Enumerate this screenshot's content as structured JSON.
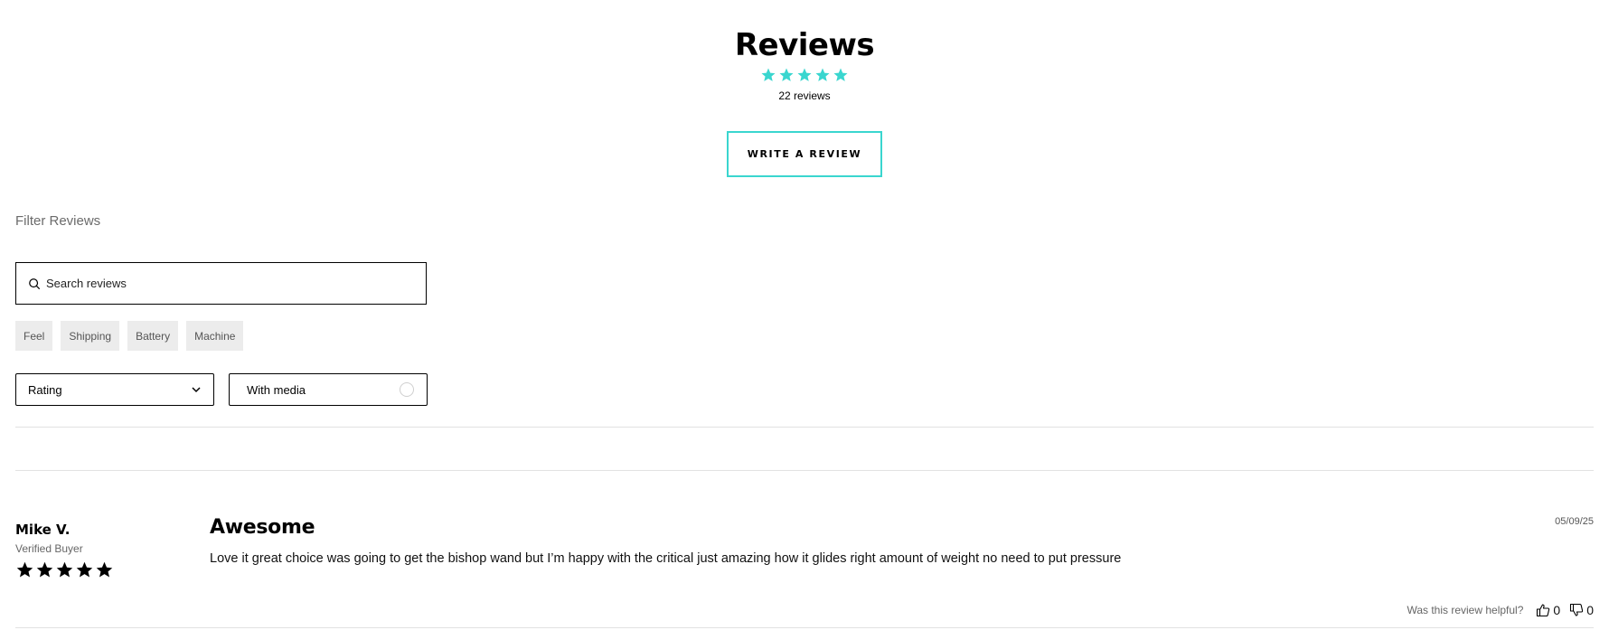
{
  "header": {
    "title": "Reviews",
    "average_rating": 5,
    "star_color": "#3ad6cf",
    "review_count": "22 reviews",
    "write_button": "WRITE A REVIEW"
  },
  "filters": {
    "title": "Filter Reviews",
    "search_placeholder": "Search reviews",
    "search_icon": "search-icon",
    "chips": [
      "Feel",
      "Shipping",
      "Battery",
      "Machine"
    ],
    "rating_select": "Rating",
    "with_media": "With media"
  },
  "reviews": [
    {
      "name": "Mike V.",
      "badge": "Verified Buyer",
      "rating": 5,
      "title": "Awesome",
      "date": "05/09/25",
      "body": "Love it great choice was going to get the bishop wand but I’m happy with the critical just amazing how it glides right amount of weight no need to put pressure",
      "helpful_label": "Was this review helpful?",
      "up_votes": "0",
      "down_votes": "0"
    }
  ],
  "colors": {
    "accent": "#3ad6cf"
  }
}
